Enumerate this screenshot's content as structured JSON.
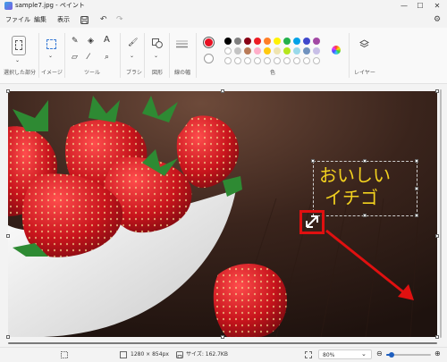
{
  "window": {
    "title": "sample7.jpg - ペイント",
    "minimize": "—",
    "maximize": "☐",
    "close": "✕"
  },
  "menu": {
    "file": "ファイル",
    "edit": "編集",
    "view": "表示"
  },
  "ribbon": {
    "select_label": "選択した部分",
    "image_label": "イメージ",
    "tools_label": "ツール",
    "brush_label": "ブラシ",
    "shapes_label": "図形",
    "size_label": "線の幅",
    "colors_label": "色",
    "layers_label": "レイヤー",
    "text_tool": "A",
    "primary_color": "#e81123",
    "palette_row1": [
      "#000000",
      "#7f7f7f",
      "#880015",
      "#ed1c24",
      "#ff7f27",
      "#fff200",
      "#22b14c",
      "#00a2e8",
      "#3f48cc",
      "#a349a4"
    ],
    "palette_row2": [
      "#ffffff",
      "#c3c3c3",
      "#b97a57",
      "#ffaec9",
      "#ffc90e",
      "#efe4b0",
      "#b5e61d",
      "#99d9ea",
      "#7092be",
      "#c8bfe7"
    ]
  },
  "canvas": {
    "overlay_line1": "おいしい",
    "overlay_line2": "イチゴ",
    "text_color": "#f2d11f",
    "arrow_color": "#e01010"
  },
  "status": {
    "dimensions": "1280 × 854px",
    "filesize": "サイズ: 162.7KB",
    "zoom": "80%",
    "zoom_slider_level": 0.12
  }
}
